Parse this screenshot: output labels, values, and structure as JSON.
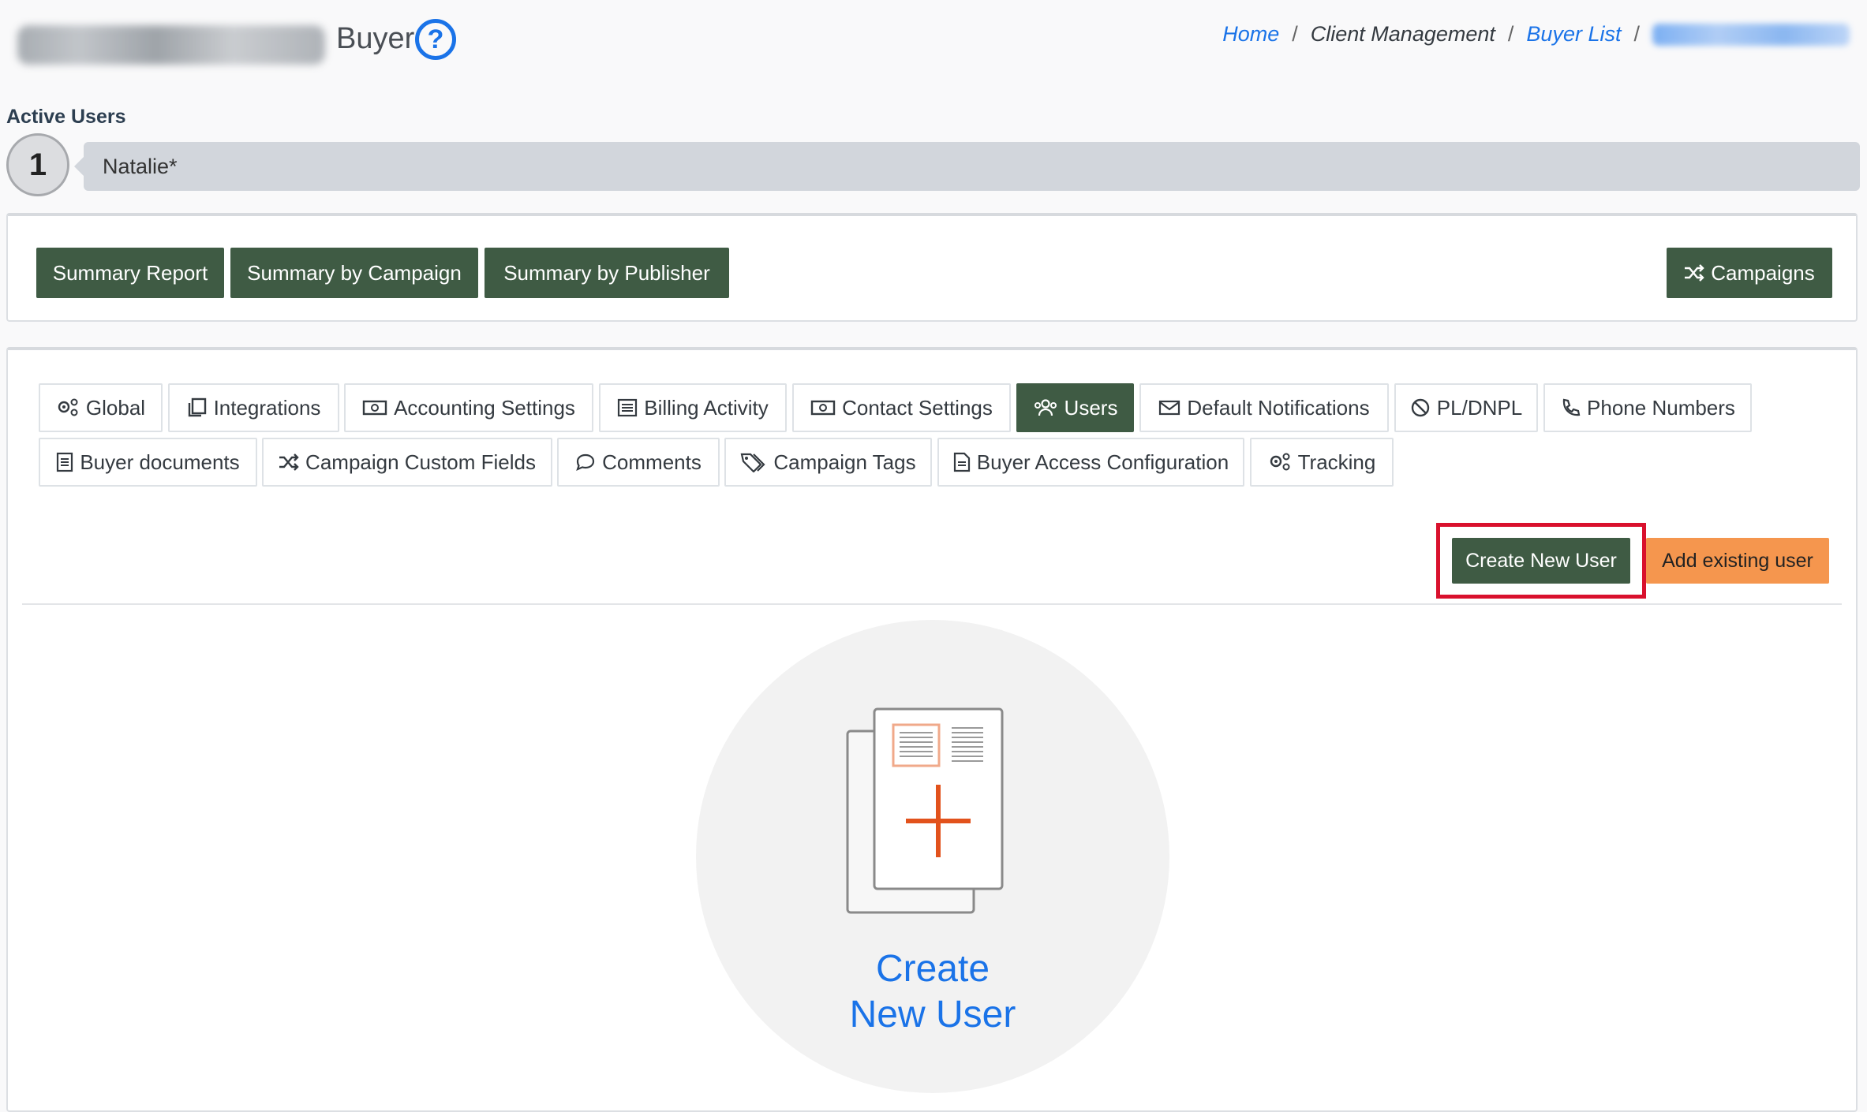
{
  "header": {
    "title_suffix": "Buyer",
    "help_icon": "question-circle-icon",
    "breadcrumb": [
      {
        "label": "Home",
        "link": true
      },
      {
        "label": "Client Management",
        "link": false
      },
      {
        "label": "Buyer List",
        "link": true
      }
    ],
    "separator": "/"
  },
  "active_users": {
    "label": "Active Users",
    "count": "1",
    "users_text": "Natalie*"
  },
  "report_buttons": {
    "summary_report": "Summary Report",
    "summary_by_campaign": "Summary by Campaign",
    "summary_by_publisher": "Summary by Publisher",
    "campaigns": "Campaigns"
  },
  "tabs": {
    "global": "Global",
    "integrations": "Integrations",
    "accounting_settings": "Accounting Settings",
    "billing_activity": "Billing Activity",
    "contact_settings": "Contact Settings",
    "users": "Users",
    "default_notifications": "Default Notifications",
    "pl_dnpl": "PL/DNPL",
    "phone_numbers": "Phone Numbers",
    "buyer_documents": "Buyer documents",
    "campaign_custom_fields": "Campaign Custom Fields",
    "comments": "Comments",
    "campaign_tags": "Campaign Tags",
    "buyer_access_configuration": "Buyer Access Configuration",
    "tracking": "Tracking",
    "active_tab": "Users"
  },
  "user_actions": {
    "create_new_user": "Create New User",
    "add_existing_user": "Add existing user"
  },
  "empty_state": {
    "line1": "Create",
    "line2": "New User"
  },
  "colors": {
    "primary_green": "#3f5b44",
    "link_blue": "#1a73e8",
    "orange": "#f5964e",
    "highlight_red": "#d9112d"
  }
}
